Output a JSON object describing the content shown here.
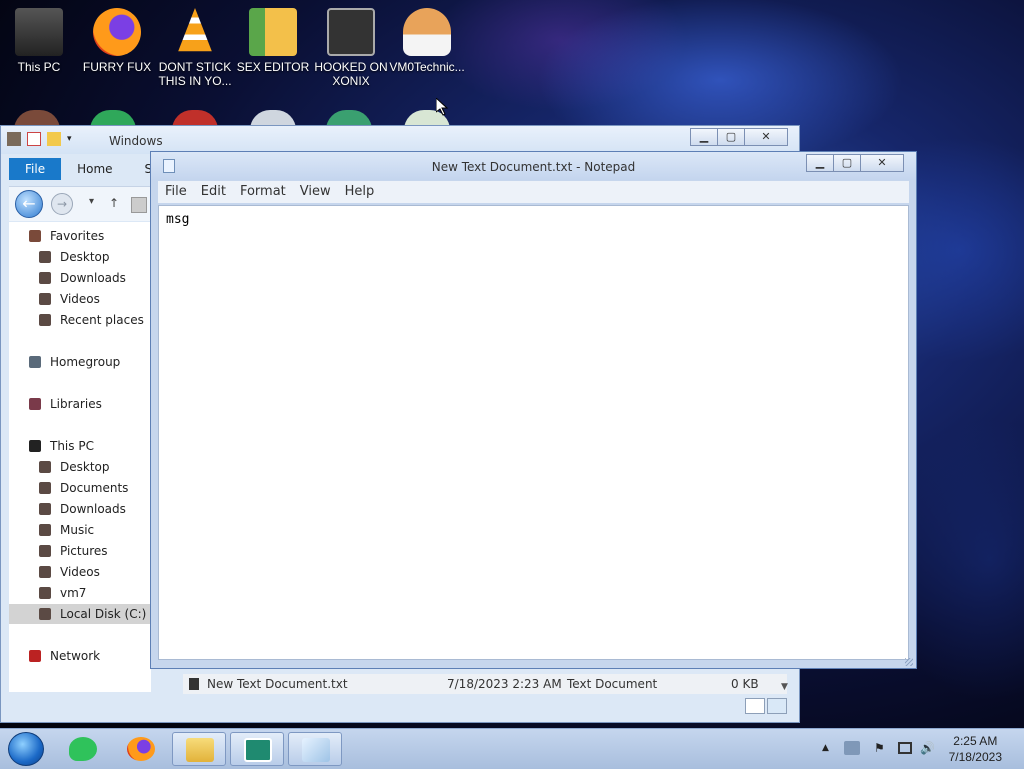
{
  "desktop": {
    "icons": [
      {
        "label": "This PC",
        "icon": "computer-icon",
        "color": "#444444"
      },
      {
        "label": "FURRY FUX",
        "icon": "firefox-icon",
        "color": "#ff7a1a"
      },
      {
        "label": "DONT STICK THIS IN YO...",
        "icon": "vlc-cone-icon",
        "color": "#f28c00"
      },
      {
        "label": "SEX EDITOR",
        "icon": "hxd-icon",
        "color": "#f3c04a"
      },
      {
        "label": "HOOKED ON XONIX",
        "icon": "xonix-game-icon",
        "color": "#666666"
      },
      {
        "label": "VM0Technic...",
        "icon": "doctor-icon",
        "color": "#e8a35a"
      }
    ]
  },
  "explorer": {
    "title": "Windows",
    "tabs": [
      "File",
      "Home",
      "Sh"
    ],
    "nav": {
      "back": "←",
      "forward": "→",
      "up": "↑"
    },
    "sidebar": [
      {
        "label": "Favorites",
        "icon": "star-icon",
        "indent": 0
      },
      {
        "label": "Desktop",
        "icon": "desktop-folder-icon",
        "indent": 1
      },
      {
        "label": "Downloads",
        "icon": "downloads-folder-icon",
        "indent": 1
      },
      {
        "label": "Videos",
        "icon": "videos-folder-icon",
        "indent": 1
      },
      {
        "label": "Recent places",
        "icon": "recent-places-icon",
        "indent": 1
      },
      {
        "label": "Homegroup",
        "icon": "homegroup-icon",
        "indent": 0
      },
      {
        "label": "Libraries",
        "icon": "libraries-icon",
        "indent": 0
      },
      {
        "label": "This PC",
        "icon": "computer-icon",
        "indent": 0
      },
      {
        "label": "Desktop",
        "icon": "desktop-folder-icon",
        "indent": 1
      },
      {
        "label": "Documents",
        "icon": "documents-folder-icon",
        "indent": 1
      },
      {
        "label": "Downloads",
        "icon": "downloads-folder-icon",
        "indent": 1
      },
      {
        "label": "Music",
        "icon": "music-folder-icon",
        "indent": 1
      },
      {
        "label": "Pictures",
        "icon": "pictures-folder-icon",
        "indent": 1
      },
      {
        "label": "Videos",
        "icon": "videos-folder-icon",
        "indent": 1
      },
      {
        "label": "vm7 (vvnmm77)",
        "icon": "network-drive-icon",
        "indent": 1
      },
      {
        "label": "Local Disk (C:)",
        "icon": "local-disk-icon",
        "indent": 1,
        "selected": true
      },
      {
        "label": "Network",
        "icon": "network-icon",
        "indent": 0
      }
    ],
    "file_row": {
      "name": "New Text Document.txt",
      "date": "7/18/2023 2:23 AM",
      "type": "Text Document",
      "size": "0 KB"
    }
  },
  "notepad": {
    "title": "New Text Document.txt - Notepad",
    "menu": [
      "File",
      "Edit",
      "Format",
      "View",
      "Help"
    ],
    "content": "msg",
    "buttons": {
      "minimize": "▁",
      "maximize": "▢",
      "close": "✕"
    }
  },
  "taskbar": {
    "apps": [
      {
        "icon": "green-app-icon",
        "color": "#2fc25b"
      },
      {
        "icon": "firefox-icon",
        "color": "#ff7a1a"
      },
      {
        "icon": "file-explorer-icon",
        "color": "#f2c94c"
      },
      {
        "icon": "download-manager-icon",
        "color": "#1f8a70"
      },
      {
        "icon": "notepad-icon",
        "color": "#9ec3e6"
      }
    ],
    "tray": {
      "chevron": "▲",
      "flag": "⚑",
      "volume": "🔊"
    },
    "clock": {
      "time": "2:25 AM",
      "date": "7/18/2023"
    }
  }
}
